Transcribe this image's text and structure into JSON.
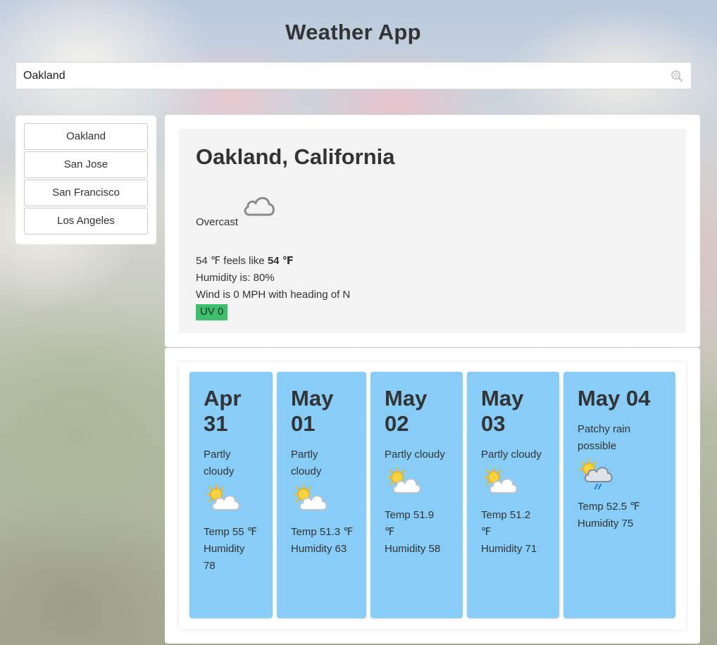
{
  "header": {
    "title": "Weather App"
  },
  "search": {
    "value": "Oakland",
    "icon": "search-icon"
  },
  "sidebar": {
    "cities": [
      {
        "label": "Oakland"
      },
      {
        "label": "San Jose"
      },
      {
        "label": "San Francisco"
      },
      {
        "label": "Los Angeles"
      }
    ]
  },
  "current": {
    "location": "Oakland, California",
    "condition": "Overcast",
    "icon": "cloud-icon",
    "temp_text": "54 ℉ feels like ",
    "feels_like": "54 ℉",
    "humidity": "Humidity is: 80%",
    "wind": "Wind is 0 MPH with heading of N",
    "uv": "UV 0",
    "uv_color": "#3dbf6e"
  },
  "forecast": {
    "card_color": "#87cdf7",
    "days": [
      {
        "date": "Apr 31",
        "condition": "Partly cloudy",
        "icon": "partly-cloudy-icon",
        "temp": "Temp 55 ℉",
        "humidity": "Humidity 78"
      },
      {
        "date": "May 01",
        "condition": "Partly cloudy",
        "icon": "partly-cloudy-icon",
        "temp": "Temp 51.3 ℉",
        "humidity": "Humidity 63"
      },
      {
        "date": "May 02",
        "condition": "Partly cloudy",
        "icon": "partly-cloudy-icon",
        "temp": "Temp 51.9 ℉",
        "humidity": "Humidity 58"
      },
      {
        "date": "May 03",
        "condition": "Partly cloudy",
        "icon": "partly-cloudy-icon",
        "temp": "Temp 51.2 ℉",
        "humidity": "Humidity 71"
      },
      {
        "date": "May 04",
        "condition": "Patchy rain possible",
        "icon": "patchy-rain-icon",
        "temp": "Temp 52.5 ℉",
        "humidity": "Humidity 75"
      }
    ]
  }
}
